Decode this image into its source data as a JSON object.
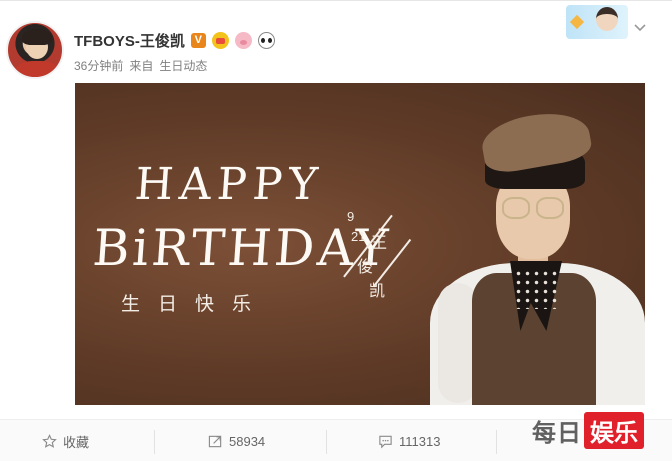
{
  "post": {
    "username": "TFBOYS-王俊凯",
    "verified_badge": "V",
    "badges": [
      "crown-icon",
      "pig-icon",
      "panda-icon"
    ],
    "time": "36分钟前",
    "source_prefix": "来自",
    "source": "生日动态"
  },
  "banner": {
    "line1": "HAPPY",
    "line2": "BiRTHDAY",
    "wish": "生日快乐",
    "date_month": "9",
    "date_day": "21",
    "name_chars": [
      "王",
      "俊",
      "凯"
    ]
  },
  "actions": {
    "favorite": "收藏",
    "repost": "58934",
    "comment": "111313"
  },
  "watermark": {
    "text": "每日",
    "brand": "娱乐"
  },
  "colors": {
    "banner_bg": "#5f3b27",
    "verified": "#e8861b",
    "watermark_red": "#e0212b"
  }
}
